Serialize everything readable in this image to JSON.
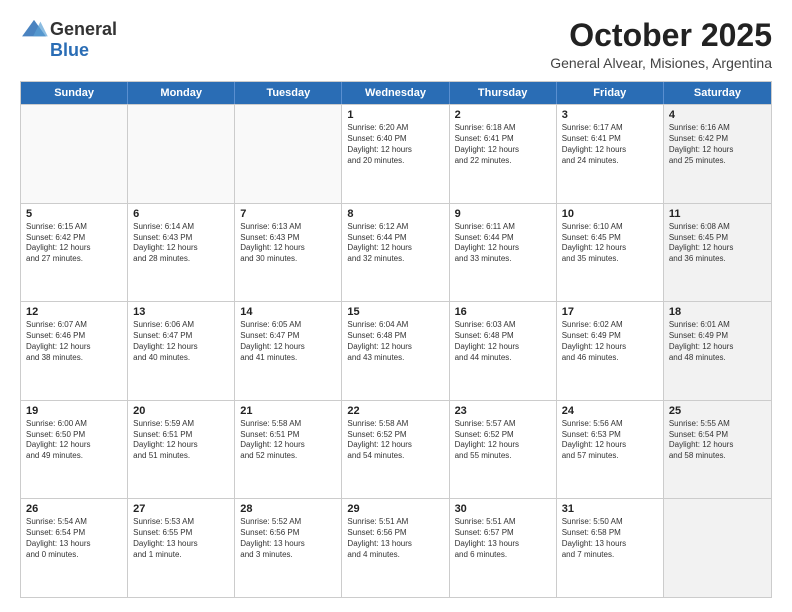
{
  "header": {
    "logo_general": "General",
    "logo_blue": "Blue",
    "month_title": "October 2025",
    "subtitle": "General Alvear, Misiones, Argentina"
  },
  "weekdays": [
    "Sunday",
    "Monday",
    "Tuesday",
    "Wednesday",
    "Thursday",
    "Friday",
    "Saturday"
  ],
  "weeks": [
    [
      {
        "day": "",
        "text": "",
        "empty": true
      },
      {
        "day": "",
        "text": "",
        "empty": true
      },
      {
        "day": "",
        "text": "",
        "empty": true
      },
      {
        "day": "1",
        "text": "Sunrise: 6:20 AM\nSunset: 6:40 PM\nDaylight: 12 hours\nand 20 minutes.",
        "empty": false
      },
      {
        "day": "2",
        "text": "Sunrise: 6:18 AM\nSunset: 6:41 PM\nDaylight: 12 hours\nand 22 minutes.",
        "empty": false
      },
      {
        "day": "3",
        "text": "Sunrise: 6:17 AM\nSunset: 6:41 PM\nDaylight: 12 hours\nand 24 minutes.",
        "empty": false
      },
      {
        "day": "4",
        "text": "Sunrise: 6:16 AM\nSunset: 6:42 PM\nDaylight: 12 hours\nand 25 minutes.",
        "empty": false,
        "shaded": true
      }
    ],
    [
      {
        "day": "5",
        "text": "Sunrise: 6:15 AM\nSunset: 6:42 PM\nDaylight: 12 hours\nand 27 minutes.",
        "empty": false
      },
      {
        "day": "6",
        "text": "Sunrise: 6:14 AM\nSunset: 6:43 PM\nDaylight: 12 hours\nand 28 minutes.",
        "empty": false
      },
      {
        "day": "7",
        "text": "Sunrise: 6:13 AM\nSunset: 6:43 PM\nDaylight: 12 hours\nand 30 minutes.",
        "empty": false
      },
      {
        "day": "8",
        "text": "Sunrise: 6:12 AM\nSunset: 6:44 PM\nDaylight: 12 hours\nand 32 minutes.",
        "empty": false
      },
      {
        "day": "9",
        "text": "Sunrise: 6:11 AM\nSunset: 6:44 PM\nDaylight: 12 hours\nand 33 minutes.",
        "empty": false
      },
      {
        "day": "10",
        "text": "Sunrise: 6:10 AM\nSunset: 6:45 PM\nDaylight: 12 hours\nand 35 minutes.",
        "empty": false
      },
      {
        "day": "11",
        "text": "Sunrise: 6:08 AM\nSunset: 6:45 PM\nDaylight: 12 hours\nand 36 minutes.",
        "empty": false,
        "shaded": true
      }
    ],
    [
      {
        "day": "12",
        "text": "Sunrise: 6:07 AM\nSunset: 6:46 PM\nDaylight: 12 hours\nand 38 minutes.",
        "empty": false
      },
      {
        "day": "13",
        "text": "Sunrise: 6:06 AM\nSunset: 6:47 PM\nDaylight: 12 hours\nand 40 minutes.",
        "empty": false
      },
      {
        "day": "14",
        "text": "Sunrise: 6:05 AM\nSunset: 6:47 PM\nDaylight: 12 hours\nand 41 minutes.",
        "empty": false
      },
      {
        "day": "15",
        "text": "Sunrise: 6:04 AM\nSunset: 6:48 PM\nDaylight: 12 hours\nand 43 minutes.",
        "empty": false
      },
      {
        "day": "16",
        "text": "Sunrise: 6:03 AM\nSunset: 6:48 PM\nDaylight: 12 hours\nand 44 minutes.",
        "empty": false
      },
      {
        "day": "17",
        "text": "Sunrise: 6:02 AM\nSunset: 6:49 PM\nDaylight: 12 hours\nand 46 minutes.",
        "empty": false
      },
      {
        "day": "18",
        "text": "Sunrise: 6:01 AM\nSunset: 6:49 PM\nDaylight: 12 hours\nand 48 minutes.",
        "empty": false,
        "shaded": true
      }
    ],
    [
      {
        "day": "19",
        "text": "Sunrise: 6:00 AM\nSunset: 6:50 PM\nDaylight: 12 hours\nand 49 minutes.",
        "empty": false
      },
      {
        "day": "20",
        "text": "Sunrise: 5:59 AM\nSunset: 6:51 PM\nDaylight: 12 hours\nand 51 minutes.",
        "empty": false
      },
      {
        "day": "21",
        "text": "Sunrise: 5:58 AM\nSunset: 6:51 PM\nDaylight: 12 hours\nand 52 minutes.",
        "empty": false
      },
      {
        "day": "22",
        "text": "Sunrise: 5:58 AM\nSunset: 6:52 PM\nDaylight: 12 hours\nand 54 minutes.",
        "empty": false
      },
      {
        "day": "23",
        "text": "Sunrise: 5:57 AM\nSunset: 6:52 PM\nDaylight: 12 hours\nand 55 minutes.",
        "empty": false
      },
      {
        "day": "24",
        "text": "Sunrise: 5:56 AM\nSunset: 6:53 PM\nDaylight: 12 hours\nand 57 minutes.",
        "empty": false
      },
      {
        "day": "25",
        "text": "Sunrise: 5:55 AM\nSunset: 6:54 PM\nDaylight: 12 hours\nand 58 minutes.",
        "empty": false,
        "shaded": true
      }
    ],
    [
      {
        "day": "26",
        "text": "Sunrise: 5:54 AM\nSunset: 6:54 PM\nDaylight: 13 hours\nand 0 minutes.",
        "empty": false
      },
      {
        "day": "27",
        "text": "Sunrise: 5:53 AM\nSunset: 6:55 PM\nDaylight: 13 hours\nand 1 minute.",
        "empty": false
      },
      {
        "day": "28",
        "text": "Sunrise: 5:52 AM\nSunset: 6:56 PM\nDaylight: 13 hours\nand 3 minutes.",
        "empty": false
      },
      {
        "day": "29",
        "text": "Sunrise: 5:51 AM\nSunset: 6:56 PM\nDaylight: 13 hours\nand 4 minutes.",
        "empty": false
      },
      {
        "day": "30",
        "text": "Sunrise: 5:51 AM\nSunset: 6:57 PM\nDaylight: 13 hours\nand 6 minutes.",
        "empty": false
      },
      {
        "day": "31",
        "text": "Sunrise: 5:50 AM\nSunset: 6:58 PM\nDaylight: 13 hours\nand 7 minutes.",
        "empty": false
      },
      {
        "day": "",
        "text": "",
        "empty": true,
        "shaded": true
      }
    ]
  ]
}
